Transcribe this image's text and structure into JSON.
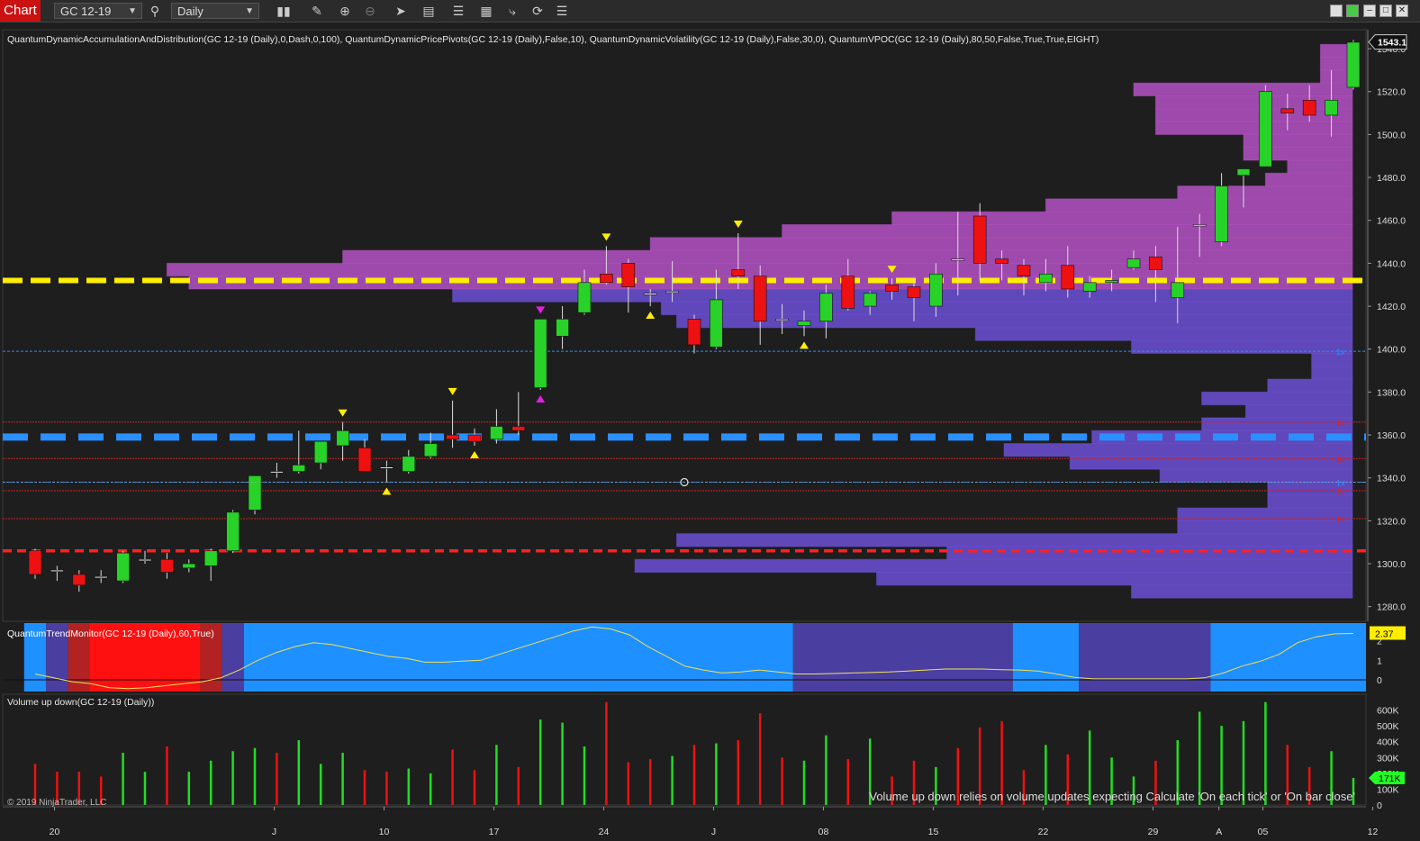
{
  "toolbar": {
    "chart_label": "Chart",
    "instrument": "GC 12-19",
    "interval": "Daily",
    "icons": [
      "search-icon",
      "bar-style-icon",
      "pencil-icon",
      "zoom-in-icon",
      "zoom-out-icon",
      "pointer-icon",
      "properties-icon",
      "indicators-icon",
      "strategies-icon",
      "chart-trader-icon",
      "refresh-icon",
      "list-icon"
    ]
  },
  "panels": {
    "price_header": "QuantumDynamicAccumulationAndDistribution(GC 12-19 (Daily),0,Dash,0,100), QuantumDynamicPricePivots(GC 12-19 (Daily),False,10), QuantumDynamicVolatility(GC 12-19 (Daily),False,30,0), QuantumVPOC(GC 12-19 (Daily),80,50,False,True,True,EIGHT)",
    "trend_header": "QuantumTrendMonitor(GC 12-19 (Daily),60,True)",
    "volume_header": "Volume up down(GC 12-19 (Daily))",
    "volume_note": "Volume up down relies on volume updates expecting Calculate 'On each tick' or 'On bar close'",
    "copyright": "© 2019 NinjaTrader, LLC"
  },
  "chart_data": [
    {
      "type": "candlestick",
      "name": "GC 12-19 (Daily)",
      "y_ticks": [
        "1540.0",
        "1520.0",
        "1500.0",
        "1480.0",
        "1460.0",
        "1440.0",
        "1420.0",
        "1400.0",
        "1380.0",
        "1360.0",
        "1340.0",
        "1320.0",
        "1300.0",
        "1280.0"
      ],
      "ylim": [
        1274,
        1548
      ],
      "last_price": "1543.1",
      "x_labels": [
        "20",
        "J",
        "10",
        "17",
        "24",
        "J",
        "08",
        "15",
        "22",
        "29",
        "A",
        "05",
        "12"
      ],
      "x_label_index": [
        1.3,
        11.3,
        16.3,
        21.3,
        26.3,
        31.3,
        36.3,
        41.3,
        46.3,
        51.3,
        54.3,
        56.3,
        61.3
      ],
      "candles": [
        {
          "o": 1306,
          "h": 1307,
          "c": 1295,
          "l": 1293
        },
        {
          "o": 1297,
          "h": 1299,
          "c": 1297,
          "l": 1292
        },
        {
          "o": 1295,
          "h": 1297,
          "c": 1290,
          "l": 1287
        },
        {
          "o": 1294,
          "h": 1297,
          "c": 1294,
          "l": 1291
        },
        {
          "o": 1292,
          "h": 1306,
          "c": 1305,
          "l": 1291
        },
        {
          "o": 1302,
          "h": 1306,
          "c": 1302,
          "l": 1300
        },
        {
          "o": 1302,
          "h": 1305,
          "c": 1296,
          "l": 1293
        },
        {
          "o": 1298,
          "h": 1302,
          "c": 1300,
          "l": 1296
        },
        {
          "o": 1299,
          "h": 1307,
          "c": 1306,
          "l": 1292
        },
        {
          "o": 1306,
          "h": 1325,
          "c": 1324,
          "l": 1305
        },
        {
          "o": 1325,
          "h": 1341,
          "c": 1341,
          "l": 1323
        },
        {
          "o": 1343,
          "h": 1347,
          "c": 1343,
          "l": 1340
        },
        {
          "o": 1343,
          "h": 1362,
          "c": 1346,
          "l": 1342
        },
        {
          "o": 1347,
          "h": 1357,
          "c": 1357,
          "l": 1344
        },
        {
          "o": 1355,
          "h": 1366,
          "c": 1362,
          "l": 1348
        },
        {
          "o": 1354,
          "h": 1358,
          "c": 1343,
          "l": 1343
        },
        {
          "o": 1345,
          "h": 1348,
          "c": 1345,
          "l": 1338
        },
        {
          "o": 1343,
          "h": 1353,
          "c": 1350,
          "l": 1342
        },
        {
          "o": 1350,
          "h": 1361,
          "c": 1356,
          "l": 1349
        },
        {
          "o": 1360,
          "h": 1376,
          "c": 1358,
          "l": 1354
        },
        {
          "o": 1360,
          "h": 1363,
          "c": 1357,
          "l": 1355
        },
        {
          "o": 1358,
          "h": 1372,
          "c": 1364,
          "l": 1356
        },
        {
          "o": 1364,
          "h": 1380,
          "c": 1362,
          "l": 1360
        },
        {
          "o": 1382,
          "h": 1414,
          "c": 1414,
          "l": 1381
        },
        {
          "o": 1406,
          "h": 1420,
          "c": 1414,
          "l": 1400
        },
        {
          "o": 1417,
          "h": 1437,
          "c": 1431,
          "l": 1416
        },
        {
          "o": 1435,
          "h": 1448,
          "c": 1431,
          "l": 1430
        },
        {
          "o": 1440,
          "h": 1442,
          "c": 1429,
          "l": 1417
        },
        {
          "o": 1426,
          "h": 1428,
          "c": 1426,
          "l": 1420
        },
        {
          "o": 1427,
          "h": 1441,
          "c": 1427,
          "l": 1422
        },
        {
          "o": 1414,
          "h": 1416,
          "c": 1402,
          "l": 1398
        },
        {
          "o": 1401,
          "h": 1437,
          "c": 1423,
          "l": 1400
        },
        {
          "o": 1437,
          "h": 1454,
          "c": 1434,
          "l": 1428
        },
        {
          "o": 1434,
          "h": 1439,
          "c": 1413,
          "l": 1402
        },
        {
          "o": 1414,
          "h": 1421,
          "c": 1414,
          "l": 1407
        },
        {
          "o": 1411,
          "h": 1418,
          "c": 1413,
          "l": 1406
        },
        {
          "o": 1413,
          "h": 1430,
          "c": 1426,
          "l": 1405
        },
        {
          "o": 1434,
          "h": 1442,
          "c": 1419,
          "l": 1418
        },
        {
          "o": 1420,
          "h": 1427,
          "c": 1426,
          "l": 1416
        },
        {
          "o": 1430,
          "h": 1433,
          "c": 1427,
          "l": 1423
        },
        {
          "o": 1429,
          "h": 1433,
          "c": 1424,
          "l": 1413
        },
        {
          "o": 1420,
          "h": 1440,
          "c": 1435,
          "l": 1415
        },
        {
          "o": 1442,
          "h": 1464,
          "c": 1442,
          "l": 1425
        },
        {
          "o": 1462,
          "h": 1468,
          "c": 1440,
          "l": 1432
        },
        {
          "o": 1442,
          "h": 1446,
          "c": 1440,
          "l": 1432
        },
        {
          "o": 1439,
          "h": 1442,
          "c": 1434,
          "l": 1425
        },
        {
          "o": 1431,
          "h": 1442,
          "c": 1435,
          "l": 1427
        },
        {
          "o": 1439,
          "h": 1448,
          "c": 1428,
          "l": 1424
        },
        {
          "o": 1427,
          "h": 1434,
          "c": 1431,
          "l": 1424
        },
        {
          "o": 1431,
          "h": 1437,
          "c": 1432,
          "l": 1427
        },
        {
          "o": 1438,
          "h": 1446,
          "c": 1442,
          "l": 1437
        },
        {
          "o": 1443,
          "h": 1448,
          "c": 1437,
          "l": 1422
        },
        {
          "o": 1424,
          "h": 1457,
          "c": 1431,
          "l": 1412
        },
        {
          "o": 1458,
          "h": 1463,
          "c": 1458,
          "l": 1443
        },
        {
          "o": 1450,
          "h": 1482,
          "c": 1476,
          "l": 1448
        },
        {
          "o": 1481,
          "h": 1484,
          "c": 1484,
          "l": 1466
        },
        {
          "o": 1485,
          "h": 1523,
          "c": 1520,
          "l": 1485
        },
        {
          "o": 1512,
          "h": 1519,
          "c": 1510,
          "l": 1502
        },
        {
          "o": 1516,
          "h": 1523,
          "c": 1509,
          "l": 1506
        },
        {
          "o": 1509,
          "h": 1530,
          "c": 1516,
          "l": 1499
        },
        {
          "o": 1522,
          "h": 1544,
          "c": 1543,
          "l": 1521
        }
      ],
      "levels": [
        {
          "name": "accumulation-yellow",
          "price": 1432,
          "color": "#ffee00"
        },
        {
          "name": "support-blue",
          "price": 1359,
          "color": "#2a8fff"
        },
        {
          "name": "vpoc-red",
          "price": 1306,
          "color": "#ff2020"
        },
        {
          "name": "vol-line-blue",
          "price": 1399,
          "color": "#2a8fff"
        },
        {
          "name": "vol-line-red-1",
          "price": 1366,
          "color": "#cc2020"
        },
        {
          "name": "vol-line-red-2",
          "price": 1349,
          "color": "#cc2020"
        },
        {
          "name": "vol-line-blue-2",
          "price": 1338,
          "color": "#2a8fff"
        },
        {
          "name": "vol-line-red-3",
          "price": 1334,
          "color": "#cc2020"
        },
        {
          "name": "vol-line-red-4",
          "price": 1321,
          "color": "#cc2020"
        }
      ],
      "pivots": [
        {
          "i": 14,
          "dir": "down",
          "color": "#ffee00"
        },
        {
          "i": 16,
          "dir": "up",
          "color": "#ffee00"
        },
        {
          "i": 19,
          "dir": "down",
          "color": "#ffee00"
        },
        {
          "i": 20,
          "dir": "up",
          "color": "#ffee00"
        },
        {
          "i": 23,
          "dir": "up",
          "color": "#e020e0"
        },
        {
          "i": 23,
          "dir": "down",
          "color": "#e020e0"
        },
        {
          "i": 26,
          "dir": "down",
          "color": "#ffee00"
        },
        {
          "i": 28,
          "dir": "up",
          "color": "#ffee00"
        },
        {
          "i": 32,
          "dir": "down",
          "color": "#ffee00"
        },
        {
          "i": 35,
          "dir": "up",
          "color": "#ffee00"
        },
        {
          "i": 39,
          "dir": "down",
          "color": "#ffee00"
        }
      ],
      "volume_profile": [
        {
          "lo": 1284,
          "hi": 1290,
          "start": 50.4
        },
        {
          "lo": 1290,
          "hi": 1296,
          "start": 38.8
        },
        {
          "lo": 1296,
          "hi": 1302,
          "start": 27.8
        },
        {
          "lo": 1302,
          "hi": 1308,
          "start": 42.0
        },
        {
          "lo": 1308,
          "hi": 1314,
          "start": 29.7
        },
        {
          "lo": 1314,
          "hi": 1320,
          "start": 52.5
        },
        {
          "lo": 1320,
          "hi": 1326,
          "start": 52.5
        },
        {
          "lo": 1326,
          "hi": 1332,
          "start": 56.6
        },
        {
          "lo": 1332,
          "hi": 1338,
          "start": 56.6
        },
        {
          "lo": 1338,
          "hi": 1344,
          "start": 51.7
        },
        {
          "lo": 1344,
          "hi": 1350,
          "start": 47.6
        },
        {
          "lo": 1350,
          "hi": 1356,
          "start": 44.6
        },
        {
          "lo": 1356,
          "hi": 1362,
          "start": 48.6
        },
        {
          "lo": 1362,
          "hi": 1368,
          "start": 53.6
        },
        {
          "lo": 1368,
          "hi": 1374,
          "start": 55.6
        },
        {
          "lo": 1374,
          "hi": 1380,
          "start": 53.6
        },
        {
          "lo": 1380,
          "hi": 1386,
          "start": 56.6
        },
        {
          "lo": 1386,
          "hi": 1392,
          "start": 58.6
        },
        {
          "lo": 1392,
          "hi": 1398,
          "start": 58.6
        },
        {
          "lo": 1398,
          "hi": 1404,
          "start": 50.4
        },
        {
          "lo": 1404,
          "hi": 1410,
          "start": 43.3
        },
        {
          "lo": 1410,
          "hi": 1416,
          "start": 29.7
        },
        {
          "lo": 1416,
          "hi": 1422,
          "start": 29.0
        },
        {
          "lo": 1422,
          "hi": 1428,
          "start": 19.5
        },
        {
          "lo": 1428,
          "hi": 1434,
          "start": 7.5
        },
        {
          "lo": 1434,
          "hi": 1440,
          "start": 6.5
        },
        {
          "lo": 1440,
          "hi": 1446,
          "start": 14.5
        },
        {
          "lo": 1446,
          "hi": 1452,
          "start": 28.5
        },
        {
          "lo": 1452,
          "hi": 1458,
          "start": 34.5
        },
        {
          "lo": 1458,
          "hi": 1464,
          "start": 39.5
        },
        {
          "lo": 1464,
          "hi": 1470,
          "start": 46.5
        },
        {
          "lo": 1470,
          "hi": 1476,
          "start": 52.5
        },
        {
          "lo": 1476,
          "hi": 1482,
          "start": 56.5
        },
        {
          "lo": 1482,
          "hi": 1488,
          "start": 57.5
        },
        {
          "lo": 1488,
          "hi": 1494,
          "start": 55.5
        },
        {
          "lo": 1494,
          "hi": 1500,
          "start": 55.5
        },
        {
          "lo": 1500,
          "hi": 1506,
          "start": 51.5
        },
        {
          "lo": 1506,
          "hi": 1512,
          "start": 51.5
        },
        {
          "lo": 1512,
          "hi": 1518,
          "start": 51.5
        },
        {
          "lo": 1518,
          "hi": 1524,
          "start": 50.5
        },
        {
          "lo": 1524,
          "hi": 1530,
          "start": 59.0
        },
        {
          "lo": 1530,
          "hi": 1536,
          "start": 59.0
        },
        {
          "lo": 1536,
          "hi": 1542,
          "start": 59.0
        },
        {
          "lo": 1542,
          "hi": 1548,
          "start": 62.0
        }
      ]
    },
    {
      "type": "line",
      "name": "QuantumTrendMonitor",
      "last_value": "2.37",
      "y_ticks": [
        "2",
        "1",
        "0"
      ],
      "ylim": [
        -0.6,
        2.9
      ],
      "values": [
        0.3,
        0.1,
        -0.1,
        -0.2,
        -0.4,
        -0.45,
        -0.4,
        -0.3,
        -0.2,
        -0.1,
        0.1,
        0.5,
        1.0,
        1.4,
        1.7,
        1.9,
        1.8,
        1.6,
        1.4,
        1.2,
        1.1,
        0.9,
        0.9,
        0.95,
        1.0,
        1.3,
        1.6,
        1.9,
        2.2,
        2.5,
        2.7,
        2.6,
        2.3,
        1.7,
        1.2,
        0.7,
        0.5,
        0.35,
        0.4,
        0.5,
        0.4,
        0.3,
        0.3,
        0.32,
        0.35,
        0.37,
        0.4,
        0.45,
        0.5,
        0.55,
        0.55,
        0.55,
        0.52,
        0.5,
        0.45,
        0.3,
        0.12,
        0.05,
        0.05,
        0.05,
        0.05,
        0.05,
        0.05,
        0.1,
        0.35,
        0.7,
        0.95,
        1.3,
        1.9,
        2.2,
        2.35,
        2.37
      ],
      "regions": [
        {
          "from": 0,
          "to": 1,
          "color": "#1e90ff"
        },
        {
          "from": 1,
          "to": 2,
          "color": "#4a3fa0"
        },
        {
          "from": 2,
          "to": 3,
          "color": "#b22222"
        },
        {
          "from": 3,
          "to": 8,
          "color": "#ff1010"
        },
        {
          "from": 8,
          "to": 9,
          "color": "#b22222"
        },
        {
          "from": 9,
          "to": 10,
          "color": "#4a3fa0"
        },
        {
          "from": 10,
          "to": 35,
          "color": "#1e90ff"
        },
        {
          "from": 35,
          "to": 45,
          "color": "#4a3fa0"
        },
        {
          "from": 45,
          "to": 48,
          "color": "#1e90ff"
        },
        {
          "from": 48,
          "to": 54,
          "color": "#4a3fa0"
        },
        {
          "from": 54,
          "to": 61.2,
          "color": "#1e90ff"
        }
      ]
    },
    {
      "type": "bar",
      "name": "Volume up down",
      "last_value": "171K",
      "y_ticks": [
        "600K",
        "500K",
        "400K",
        "300K",
        "200K",
        "100K",
        "0"
      ],
      "ylim": [
        0,
        700000
      ],
      "values": [
        260000,
        210000,
        210000,
        180000,
        330000,
        210000,
        370000,
        210000,
        280000,
        340000,
        360000,
        330000,
        410000,
        260000,
        330000,
        220000,
        210000,
        230000,
        200000,
        350000,
        220000,
        380000,
        240000,
        540000,
        520000,
        370000,
        650000,
        270000,
        290000,
        310000,
        380000,
        390000,
        410000,
        580000,
        300000,
        280000,
        440000,
        290000,
        420000,
        180000,
        280000,
        240000,
        360000,
        490000,
        530000,
        220000,
        380000,
        320000,
        470000,
        300000,
        180000,
        280000,
        410000,
        590000,
        500000,
        530000,
        650000,
        380000,
        240000,
        340000,
        171000
      ],
      "up": [
        false,
        false,
        false,
        false,
        true,
        true,
        false,
        true,
        true,
        true,
        true,
        false,
        true,
        true,
        true,
        false,
        false,
        true,
        true,
        false,
        false,
        true,
        false,
        true,
        true,
        true,
        false,
        false,
        false,
        true,
        false,
        true,
        false,
        false,
        false,
        true,
        true,
        false,
        true,
        false,
        false,
        true,
        false,
        false,
        false,
        false,
        true,
        false,
        true,
        true,
        true,
        false,
        true,
        true,
        true,
        true,
        true,
        false,
        false,
        true,
        true
      ]
    }
  ],
  "labels_1x": [
    "1x",
    "1x",
    "1x",
    "1x",
    "1x",
    "1x"
  ]
}
